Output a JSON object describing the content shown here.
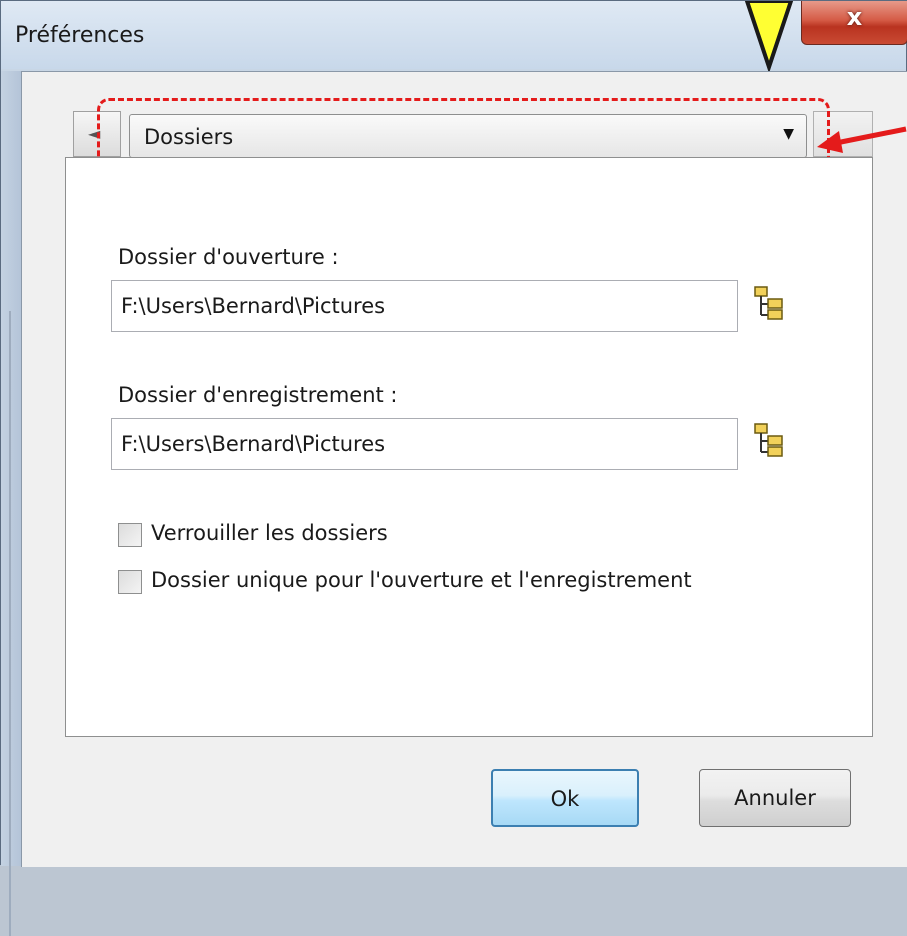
{
  "window": {
    "title": "Préférences",
    "close_label": "x"
  },
  "tabs": {
    "selected_category": "Dossiers"
  },
  "fields": {
    "open_folder": {
      "label": "Dossier d'ouverture :",
      "value": "F:\\Users\\Bernard\\Pictures"
    },
    "save_folder": {
      "label": "Dossier d'enregistrement :",
      "value": "F:\\Users\\Bernard\\Pictures"
    }
  },
  "options": [
    {
      "label": "Verrouiller les dossiers",
      "checked": false
    },
    {
      "label": "Dossier unique pour l'ouverture et l'enregistrement",
      "checked": false
    }
  ],
  "buttons": {
    "ok": "Ok",
    "cancel": "Annuler"
  },
  "colors": {
    "highlight_dashed": "#e41b1b",
    "callout_arrow": "#e41b1b",
    "callout_yellow": "#ffff33"
  },
  "icons": {
    "folder_browse": "folder-tree-icon",
    "tab_scroll": "left-arrow-icon",
    "dropdown": "chevron-down-icon"
  }
}
